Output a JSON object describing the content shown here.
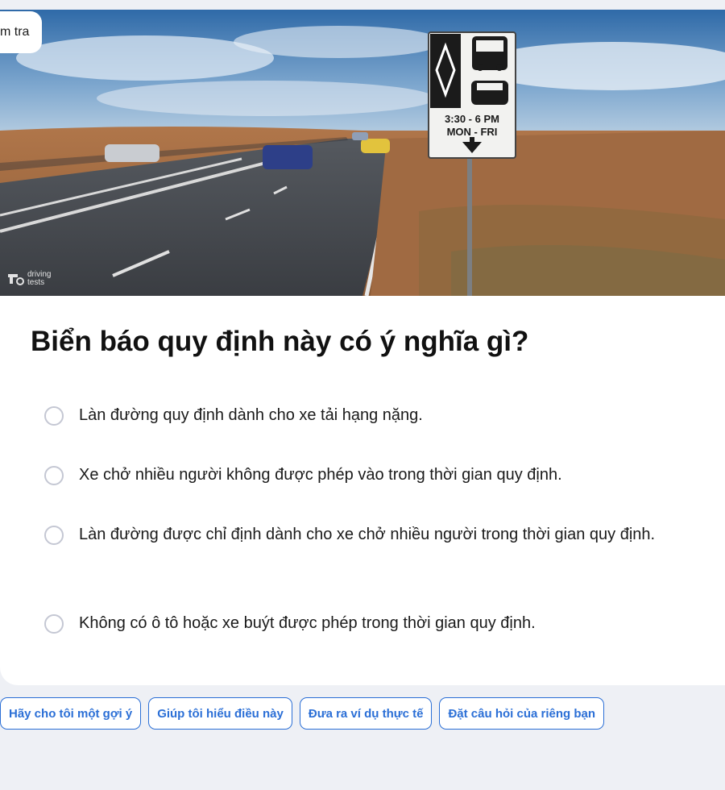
{
  "badge": {
    "label": "m tra"
  },
  "hero": {
    "watermark": [
      "driving",
      "tests"
    ],
    "sign": {
      "time": "3:30 - 6 PM",
      "days": "MON - FRI"
    }
  },
  "question": "Biển báo quy định này có ý nghĩa gì?",
  "options": [
    {
      "label": "Làn đường quy định dành cho xe tải hạng nặng."
    },
    {
      "label": "Xe chở nhiều người không được phép vào trong thời gian quy định."
    },
    {
      "label": "Làn đường được chỉ định dành cho xe chở nhiều người trong thời gian quy định."
    },
    {
      "label": "Không có ô tô hoặc xe buýt được phép trong thời gian quy định."
    }
  ],
  "chips": [
    {
      "label": "Hãy cho tôi một gợi ý"
    },
    {
      "label": "Giúp tôi hiểu điều này"
    },
    {
      "label": "Đưa ra ví dụ thực tế"
    },
    {
      "label": "Đặt câu hỏi của riêng bạn"
    }
  ],
  "colors": {
    "accent": "#2b6fd6",
    "radio_border": "#c4c7d3",
    "page_bg": "#eef0f5"
  }
}
